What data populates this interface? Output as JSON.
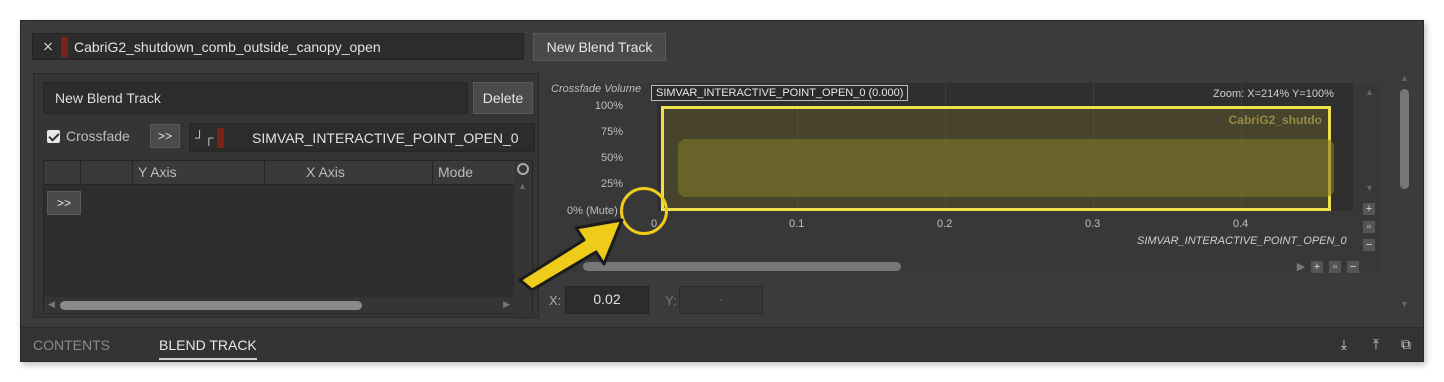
{
  "track": {
    "name": "CabriG2_shutdown_comb_outside_canopy_open",
    "new_blend_track_label": "New Blend Track"
  },
  "blend": {
    "name": "New Blend Track",
    "delete_label": "Delete",
    "crossfade_label": "Crossfade",
    "crossfade_checked": true,
    "expand_label": ">>",
    "simvar": "SIMVAR_INTERACTIVE_POINT_OPEN_0"
  },
  "table": {
    "columns": [
      "Y Axis",
      "X Axis",
      "Mode"
    ],
    "row_button_label": ">>"
  },
  "graph": {
    "y_label": "Crossfade Volume",
    "tooltip": "SIMVAR_INTERACTIVE_POINT_OPEN_0 (0.000)",
    "zoom": "Zoom: X=214% Y=100%",
    "block_label": "CabriG2_shutdo",
    "y_ticks": [
      "100%",
      "75%",
      "50%",
      "25%",
      "0% (Mute)"
    ],
    "x_ticks": [
      "0",
      "0.1",
      "0.2",
      "0.3",
      "0.4"
    ],
    "x_axis_label": "SIMVAR_INTERACTIVE_POINT_OPEN_0",
    "block_color": "#ece04c"
  },
  "coords": {
    "x_label": "X:",
    "x_value": "0.02",
    "y_label": "Y:",
    "y_value": "-"
  },
  "tabs": {
    "contents": "CONTENTS",
    "blend_track": "BLEND TRACK"
  },
  "colors": {
    "annotation": "#f0cc1a",
    "swatch": "#7a2418"
  }
}
